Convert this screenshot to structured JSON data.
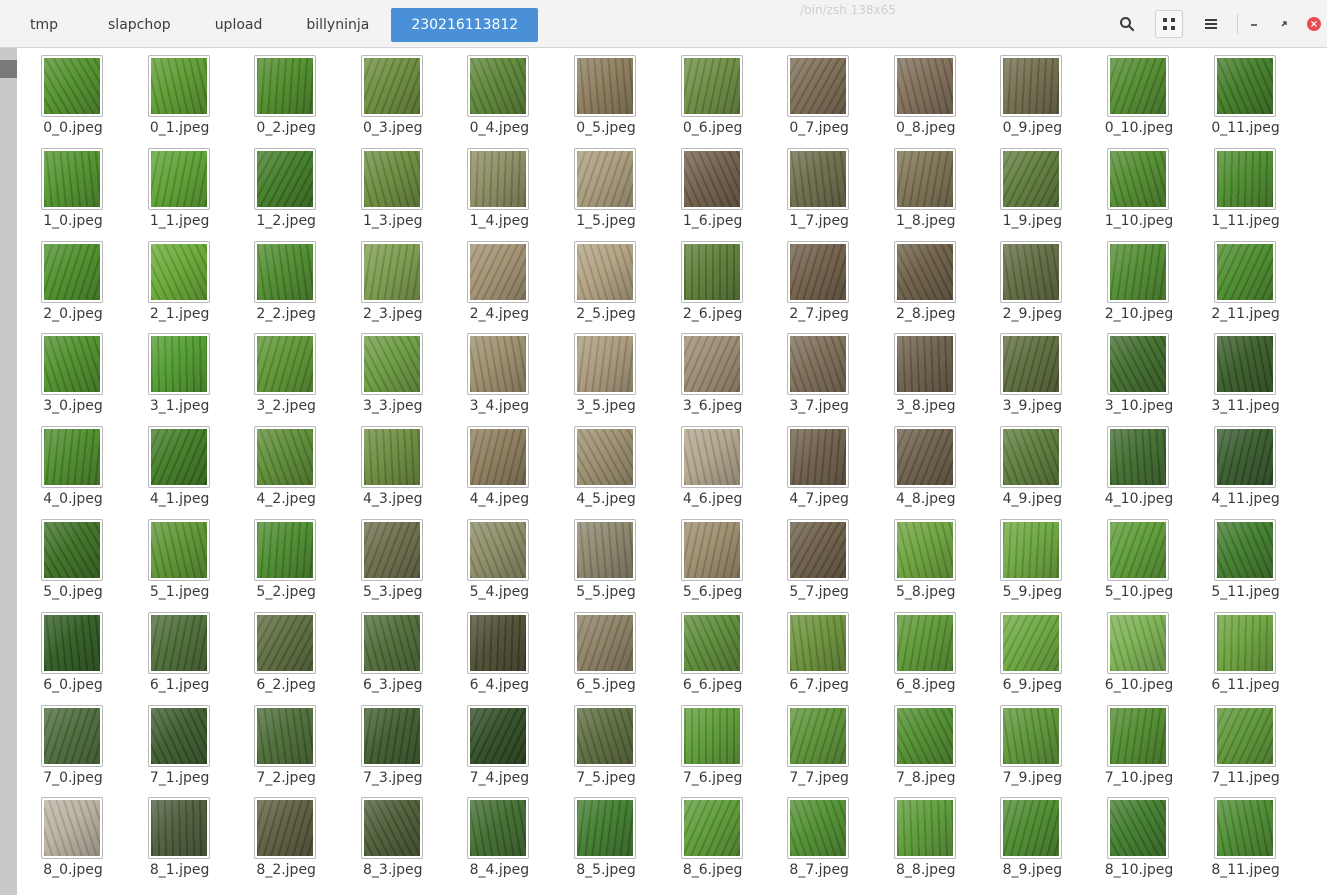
{
  "window": {
    "title": "/bin/zsh 138x65"
  },
  "tabs": [
    {
      "label": "tmp"
    },
    {
      "label": "slapchop"
    },
    {
      "label": "upload"
    },
    {
      "label": "billyninja"
    },
    {
      "label": "230216113812"
    }
  ],
  "active_tab_index": 4,
  "icons": {
    "search": "search-icon",
    "grid": "grid-view-icon",
    "menu": "hamburger-menu-icon",
    "minimize": "minimize-icon",
    "restore": "restore-icon",
    "close": "close-icon"
  },
  "colors": {
    "accent": "#4a90d9",
    "close": "#e74c55"
  },
  "files": {
    "rows": 9,
    "cols": 12,
    "extension": ".jpeg",
    "names": [
      [
        "0_0.jpeg",
        "0_1.jpeg",
        "0_2.jpeg",
        "0_3.jpeg",
        "0_4.jpeg",
        "0_5.jpeg",
        "0_6.jpeg",
        "0_7.jpeg",
        "0_8.jpeg",
        "0_9.jpeg",
        "0_10.jpeg",
        "0_11.jpeg"
      ],
      [
        "1_0.jpeg",
        "1_1.jpeg",
        "1_2.jpeg",
        "1_3.jpeg",
        "1_4.jpeg",
        "1_5.jpeg",
        "1_6.jpeg",
        "1_7.jpeg",
        "1_8.jpeg",
        "1_9.jpeg",
        "1_10.jpeg",
        "1_11.jpeg"
      ],
      [
        "2_0.jpeg",
        "2_1.jpeg",
        "2_2.jpeg",
        "2_3.jpeg",
        "2_4.jpeg",
        "2_5.jpeg",
        "2_6.jpeg",
        "2_7.jpeg",
        "2_8.jpeg",
        "2_9.jpeg",
        "2_10.jpeg",
        "2_11.jpeg"
      ],
      [
        "3_0.jpeg",
        "3_1.jpeg",
        "3_2.jpeg",
        "3_3.jpeg",
        "3_4.jpeg",
        "3_5.jpeg",
        "3_6.jpeg",
        "3_7.jpeg",
        "3_8.jpeg",
        "3_9.jpeg",
        "3_10.jpeg",
        "3_11.jpeg"
      ],
      [
        "4_0.jpeg",
        "4_1.jpeg",
        "4_2.jpeg",
        "4_3.jpeg",
        "4_4.jpeg",
        "4_5.jpeg",
        "4_6.jpeg",
        "4_7.jpeg",
        "4_8.jpeg",
        "4_9.jpeg",
        "4_10.jpeg",
        "4_11.jpeg"
      ],
      [
        "5_0.jpeg",
        "5_1.jpeg",
        "5_2.jpeg",
        "5_3.jpeg",
        "5_4.jpeg",
        "5_5.jpeg",
        "5_6.jpeg",
        "5_7.jpeg",
        "5_8.jpeg",
        "5_9.jpeg",
        "5_10.jpeg",
        "5_11.jpeg"
      ],
      [
        "6_0.jpeg",
        "6_1.jpeg",
        "6_2.jpeg",
        "6_3.jpeg",
        "6_4.jpeg",
        "6_5.jpeg",
        "6_6.jpeg",
        "6_7.jpeg",
        "6_8.jpeg",
        "6_9.jpeg",
        "6_10.jpeg",
        "6_11.jpeg"
      ],
      [
        "7_0.jpeg",
        "7_1.jpeg",
        "7_2.jpeg",
        "7_3.jpeg",
        "7_4.jpeg",
        "7_5.jpeg",
        "7_6.jpeg",
        "7_7.jpeg",
        "7_8.jpeg",
        "7_9.jpeg",
        "7_10.jpeg",
        "7_11.jpeg"
      ],
      [
        "8_0.jpeg",
        "8_1.jpeg",
        "8_2.jpeg",
        "8_3.jpeg",
        "8_4.jpeg",
        "8_5.jpeg",
        "8_6.jpeg",
        "8_7.jpeg",
        "8_8.jpeg",
        "8_9.jpeg",
        "8_10.jpeg",
        "8_11.jpeg"
      ]
    ],
    "thumbnail_palette": [
      [
        "#4f8f2a",
        "#5a9a2e",
        "#4c8a28",
        "#6a8a3a",
        "#5a8434",
        "#8a7a5a",
        "#6a8a40",
        "#7a6a52",
        "#7d6b55",
        "#6f6a4a",
        "#4f8a2c",
        "#3f7a24"
      ],
      [
        "#4e922b",
        "#5aa030",
        "#3f7a24",
        "#6a8a3c",
        "#8a8a60",
        "#a89a7a",
        "#6e5c48",
        "#6a6a48",
        "#7a7050",
        "#5e7a3a",
        "#4f8a2c",
        "#4a8a2a"
      ],
      [
        "#4a8e28",
        "#66a832",
        "#4c8a2c",
        "#7a9a4a",
        "#a08f70",
        "#b0a080",
        "#5a7a34",
        "#6e5c46",
        "#6a5c44",
        "#5e6a40",
        "#4e8a2e",
        "#4a8a2a"
      ],
      [
        "#4c8e29",
        "#4f9a2c",
        "#5a9430",
        "#6a9a40",
        "#9a8c6a",
        "#a8987a",
        "#9a8a70",
        "#7a6a54",
        "#6a5c48",
        "#5a6a3a",
        "#3e6a2a",
        "#365a26"
      ],
      [
        "#4a8a28",
        "#3e7a22",
        "#5a8a32",
        "#6a8a3c",
        "#8a7a5a",
        "#9a8c6c",
        "#b0a48a",
        "#6c5c48",
        "#6a5c48",
        "#5a7a38",
        "#3e6a2c",
        "#34582a"
      ],
      [
        "#3a6e22",
        "#5a9430",
        "#4a8a2c",
        "#6a6a48",
        "#8a8a64",
        "#8a846a",
        "#9a8a6a",
        "#6a5c46",
        "#6aa23a",
        "#6aa63c",
        "#5a9a34",
        "#3e7a2a"
      ],
      [
        "#2e5a20",
        "#4a6a34",
        "#5a6a3c",
        "#4e6a36",
        "#4a4a30",
        "#8a7e62",
        "#5a8a36",
        "#6a9038",
        "#5a9632",
        "#6aa83e",
        "#7ab050",
        "#6aa23c"
      ],
      [
        "#4a6a3a",
        "#3a5a2c",
        "#4a6a34",
        "#3e5a2c",
        "#2e4a22",
        "#5a6a3c",
        "#5a9a34",
        "#5a9234",
        "#4e8c2c",
        "#5a9434",
        "#4e8a2c",
        "#5a9434"
      ],
      [
        "#b8b0a0",
        "#4a5a38",
        "#5a5a3c",
        "#4a5a34",
        "#3e6a2c",
        "#3e7a2c",
        "#5a9a34",
        "#4e8e2e",
        "#5a9a36",
        "#4a8a2c",
        "#3e7a2a",
        "#4a8a2e"
      ]
    ]
  }
}
